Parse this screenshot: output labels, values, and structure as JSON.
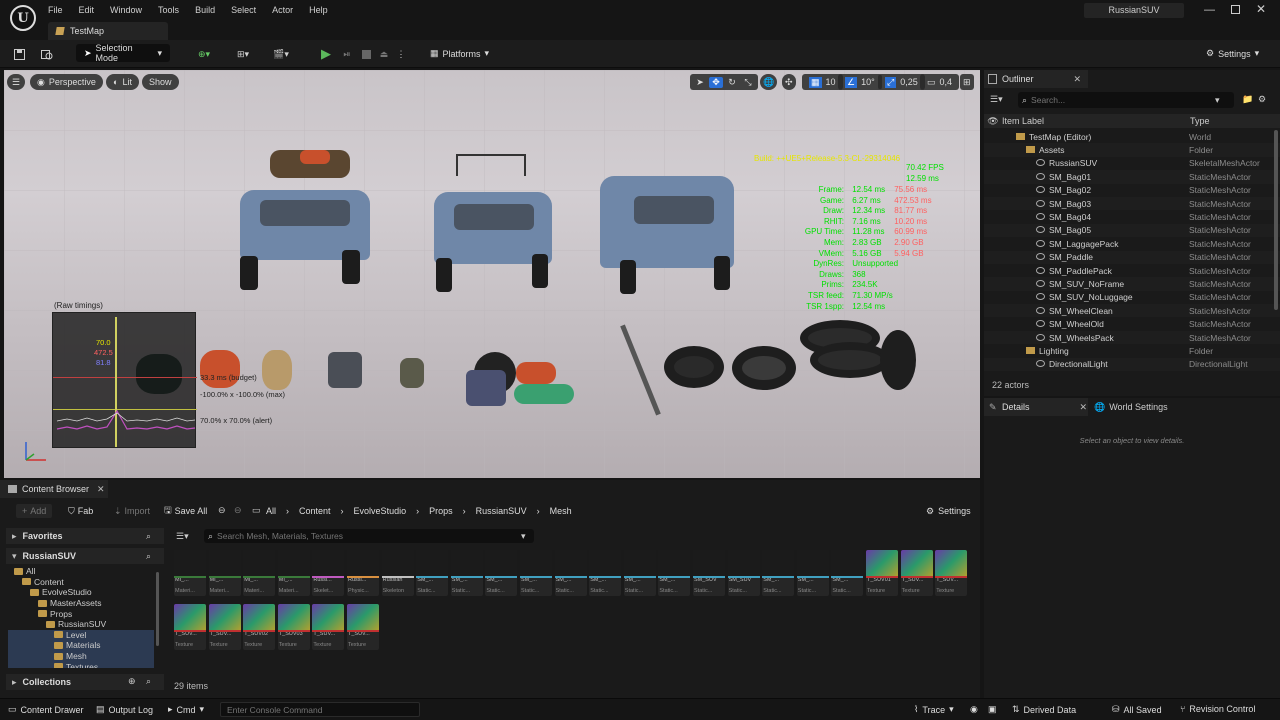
{
  "menu": [
    "File",
    "Edit",
    "Window",
    "Tools",
    "Build",
    "Select",
    "Actor",
    "Help"
  ],
  "project_name": "RussianSUV",
  "tab_title": "TestMap",
  "toolbar": {
    "selection_mode": "Selection Mode",
    "platforms": "Platforms",
    "settings": "Settings"
  },
  "viewport": {
    "perspective": "Perspective",
    "lit": "Lit",
    "show": "Show",
    "grid_snap": "10",
    "rot_snap": "10°",
    "scale_snap": "0,25",
    "camera_speed": "0,4",
    "build_line": "Build: ++UE5+Release-5.3-CL-29314046",
    "fps": "70.42 FPS",
    "ms": "12.59 ms",
    "stats": [
      {
        "label": "Frame:",
        "v1": "12.54 ms",
        "v2": "75.56 ms"
      },
      {
        "label": "Game:",
        "v1": "6.27 ms",
        "v2": "472.53 ms"
      },
      {
        "label": "Draw:",
        "v1": "12.34 ms",
        "v2": "81.77 ms"
      },
      {
        "label": "RHIT:",
        "v1": "7.16 ms",
        "v2": "10.20 ms"
      },
      {
        "label": "GPU Time:",
        "v1": "11.28 ms",
        "v2": "60.99 ms"
      },
      {
        "label": "Mem:",
        "v1": "2.83 GB",
        "v2": "2.90 GB"
      },
      {
        "label": "VMem:",
        "v1": "5.16 GB",
        "v2": "5.94 GB"
      },
      {
        "label": "DynRes:",
        "v1": "Unsupported",
        "v2": ""
      },
      {
        "label": "Draws:",
        "v1": "368",
        "v2": ""
      },
      {
        "label": "Prims:",
        "v1": "234.5K",
        "v2": ""
      },
      {
        "label": "TSR feed:",
        "v1": "71.30 MP/s",
        "v2": ""
      },
      {
        "label": "TSR 1spp:",
        "v1": "12.54 ms",
        "v2": ""
      }
    ],
    "graph_title": "(Raw timings)",
    "graph_values": [
      "70.0",
      "472.5",
      "81.8"
    ],
    "graph_budget": "33.3 ms (budget)",
    "graph_max": "-100.0% x -100.0% (max)",
    "graph_alert": "70.0% x 70.0% (alert)"
  },
  "outliner": {
    "title": "Outliner",
    "search_placeholder": "Search...",
    "col_label": "Item Label",
    "col_type": "Type",
    "rows": [
      {
        "label": "TestMap (Editor)",
        "type": "World",
        "indent": 1
      },
      {
        "label": "Assets",
        "type": "Folder",
        "indent": 2
      },
      {
        "label": "RussianSUV",
        "type": "SkeletalMeshActor",
        "indent": 3
      },
      {
        "label": "SM_Bag01",
        "type": "StaticMeshActor",
        "indent": 3
      },
      {
        "label": "SM_Bag02",
        "type": "StaticMeshActor",
        "indent": 3
      },
      {
        "label": "SM_Bag03",
        "type": "StaticMeshActor",
        "indent": 3
      },
      {
        "label": "SM_Bag04",
        "type": "StaticMeshActor",
        "indent": 3
      },
      {
        "label": "SM_Bag05",
        "type": "StaticMeshActor",
        "indent": 3
      },
      {
        "label": "SM_LaggagePack",
        "type": "StaticMeshActor",
        "indent": 3
      },
      {
        "label": "SM_Paddle",
        "type": "StaticMeshActor",
        "indent": 3
      },
      {
        "label": "SM_PaddlePack",
        "type": "StaticMeshActor",
        "indent": 3
      },
      {
        "label": "SM_SUV_NoFrame",
        "type": "StaticMeshActor",
        "indent": 3
      },
      {
        "label": "SM_SUV_NoLuggage",
        "type": "StaticMeshActor",
        "indent": 3
      },
      {
        "label": "SM_WheelClean",
        "type": "StaticMeshActor",
        "indent": 3
      },
      {
        "label": "SM_WheelOld",
        "type": "StaticMeshActor",
        "indent": 3
      },
      {
        "label": "SM_WheelsPack",
        "type": "StaticMeshActor",
        "indent": 3
      },
      {
        "label": "Lighting",
        "type": "Folder",
        "indent": 2
      },
      {
        "label": "DirectionalLight",
        "type": "DirectionalLight",
        "indent": 3
      }
    ],
    "actor_count": "22 actors"
  },
  "details": {
    "tab": "Details",
    "world_tab": "World Settings",
    "empty": "Select an object to view details."
  },
  "content_browser": {
    "tab": "Content Browser",
    "add": "Add",
    "fab": "Fab",
    "import": "Import",
    "save_all": "Save All",
    "path": [
      "All",
      "Content",
      "EvolveStudio",
      "Props",
      "RussianSUV",
      "Mesh"
    ],
    "settings": "Settings",
    "favorites": "Favorites",
    "project": "RussianSUV",
    "collections": "Collections",
    "search_placeholder": "Search Mesh, Materials, Textures",
    "tree": [
      {
        "label": "All",
        "indent": 0
      },
      {
        "label": "Content",
        "indent": 1
      },
      {
        "label": "EvolveStudio",
        "indent": 2
      },
      {
        "label": "MasterAssets",
        "indent": 3
      },
      {
        "label": "Props",
        "indent": 3
      },
      {
        "label": "RussianSUV",
        "indent": 4
      },
      {
        "label": "Level",
        "indent": 5
      },
      {
        "label": "Materials",
        "indent": 5
      },
      {
        "label": "Mesh",
        "indent": 5
      },
      {
        "label": "Textures",
        "indent": 5
      }
    ],
    "items_count": "29 items",
    "assets": [
      {
        "n": "MI_...",
        "t": "Materi...",
        "c": "#3a7a3a"
      },
      {
        "n": "MI_...",
        "t": "Materi...",
        "c": "#3a7a3a"
      },
      {
        "n": "MI_...",
        "t": "Materi...",
        "c": "#3a7a3a"
      },
      {
        "n": "MI_...",
        "t": "Materi...",
        "c": "#3a7a3a"
      },
      {
        "n": "Russi...",
        "t": "Skelet...",
        "c": "#c05ac0"
      },
      {
        "n": "Russi...",
        "t": "Physic...",
        "c": "#d89040"
      },
      {
        "n": "Russian",
        "t": "Skeleton",
        "c": "#c0c0c0"
      },
      {
        "n": "SM_...",
        "t": "Static...",
        "c": "#40a0c0"
      },
      {
        "n": "SM_...",
        "t": "Static...",
        "c": "#40a0c0"
      },
      {
        "n": "SM_...",
        "t": "Static...",
        "c": "#40a0c0"
      },
      {
        "n": "SM_...",
        "t": "Static...",
        "c": "#40a0c0"
      },
      {
        "n": "SM_...",
        "t": "Static...",
        "c": "#40a0c0"
      },
      {
        "n": "SM_...",
        "t": "Static...",
        "c": "#40a0c0"
      },
      {
        "n": "SM_...",
        "t": "Static...",
        "c": "#40a0c0"
      },
      {
        "n": "SM_...",
        "t": "Static...",
        "c": "#40a0c0"
      },
      {
        "n": "SM_SUV",
        "t": "Static...",
        "c": "#40a0c0"
      },
      {
        "n": "SM_SUV",
        "t": "Static...",
        "c": "#40a0c0"
      },
      {
        "n": "SM_...",
        "t": "Static...",
        "c": "#40a0c0"
      },
      {
        "n": "SM_...",
        "t": "Static...",
        "c": "#40a0c0"
      },
      {
        "n": "SM_...",
        "t": "Static...",
        "c": "#40a0c0"
      },
      {
        "n": "T_SUV01",
        "t": "Texture",
        "c": "#c03030"
      },
      {
        "n": "T_SUV...",
        "t": "Texture",
        "c": "#c03030"
      },
      {
        "n": "T_SUV...",
        "t": "Texture",
        "c": "#c03030"
      },
      {
        "n": "T_SUV...",
        "t": "Texture",
        "c": "#c03030"
      },
      {
        "n": "T_SUV...",
        "t": "Texture",
        "c": "#c03030"
      },
      {
        "n": "T_SUV02",
        "t": "Texture",
        "c": "#c03030"
      },
      {
        "n": "T_SUV03",
        "t": "Texture",
        "c": "#c03030"
      },
      {
        "n": "T_SUV...",
        "t": "Texture",
        "c": "#c03030"
      },
      {
        "n": "T_SUV...",
        "t": "Texture",
        "c": "#c03030"
      }
    ]
  },
  "status": {
    "content_drawer": "Content Drawer",
    "output_log": "Output Log",
    "cmd": "Cmd",
    "console_placeholder": "Enter Console Command",
    "trace": "Trace",
    "derived_data": "Derived Data",
    "all_saved": "All Saved",
    "revision_control": "Revision Control"
  }
}
